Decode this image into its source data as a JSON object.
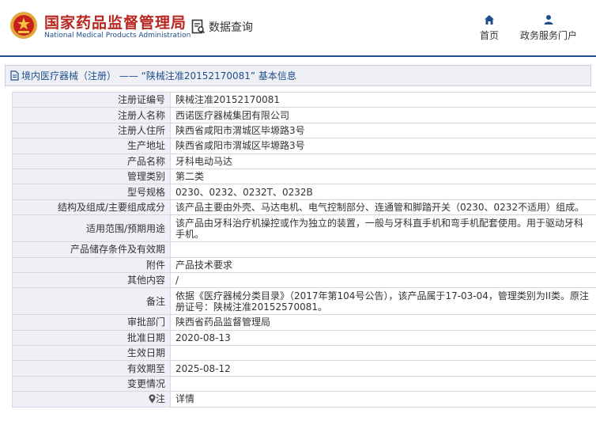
{
  "header": {
    "brand_cn": "国家药品监督管理局",
    "brand_en": "National Medical Products Administration",
    "search_label": "数据查询",
    "nav": {
      "home": "首页",
      "service": "政务服务门户"
    }
  },
  "breadcrumb": {
    "category": "境内医疗器械（注册）",
    "separator": "——",
    "registration": "“陕械注准20152170081”",
    "suffix": "基本信息"
  },
  "details": [
    {
      "key": "注册证编号",
      "value": "陕械注准20152170081"
    },
    {
      "key": "注册人名称",
      "value": "西诺医疗器械集团有限公司"
    },
    {
      "key": "注册人住所",
      "value": "陕西省咸阳市渭城区毕塬路3号"
    },
    {
      "key": "生产地址",
      "value": "陕西省咸阳市渭城区毕塬路3号"
    },
    {
      "key": "产品名称",
      "value": "牙科电动马达"
    },
    {
      "key": "管理类别",
      "value": "第二类"
    },
    {
      "key": "型号规格",
      "value": "0230、0232、0232T、0232B"
    },
    {
      "key": "结构及组成/主要组成成分",
      "value": "该产品主要由外壳、马达电机、电气控制部分、连通管和脚踏开关（0230、0232不适用）组成。"
    },
    {
      "key": "适用范围/预期用途",
      "value": "该产品由牙科治疗机操控或作为独立的装置，一般与牙科直手机和弯手机配套使用。用于驱动牙科手机。"
    },
    {
      "key": "产品储存条件及有效期",
      "value": ""
    },
    {
      "key": "附件",
      "value": "产品技术要求"
    },
    {
      "key": "其他内容",
      "value": "/"
    },
    {
      "key": "备注",
      "value": "依据《医疗器械分类目录》（2017年第104号公告），该产品属于17-03-04，管理类别为II类。原注册证号：陕械注准20152570081。"
    },
    {
      "key": "审批部门",
      "value": "陕西省药品监督管理局"
    },
    {
      "key": "批准日期",
      "value": "2020-08-13"
    },
    {
      "key": "生效日期",
      "value": ""
    },
    {
      "key": "有效期至",
      "value": "2025-08-12"
    },
    {
      "key": "变更情况",
      "value": ""
    }
  ],
  "note": {
    "key": "注",
    "value": "详情"
  },
  "colors": {
    "brand_red": "#b7271f",
    "nav_blue": "#1f4e8c",
    "label_bg": "#eef0f5",
    "link": "#1f6fd6"
  }
}
